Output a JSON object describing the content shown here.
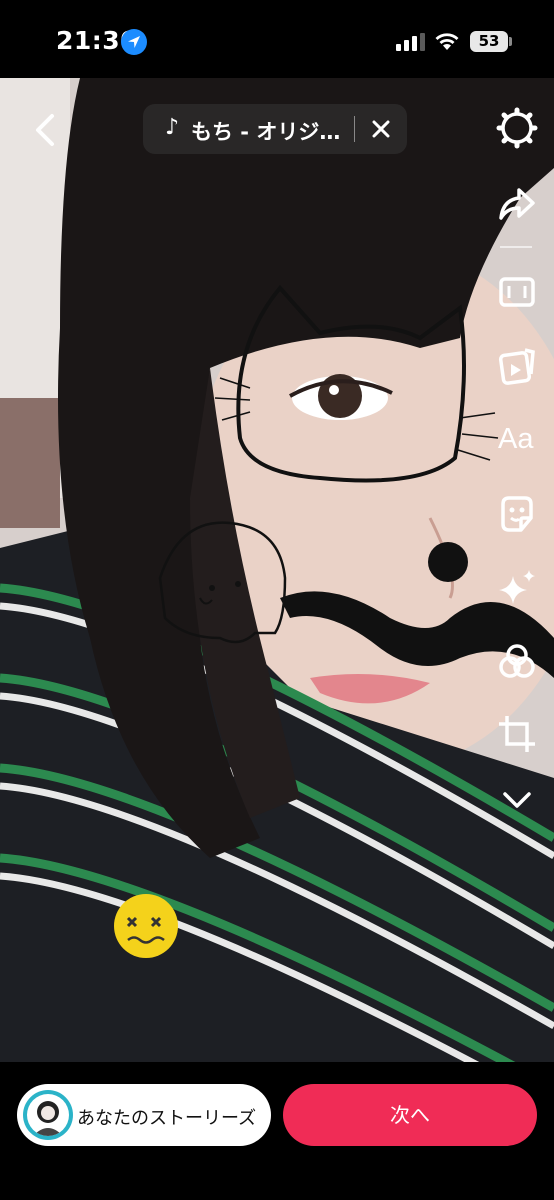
{
  "status_bar": {
    "time": "21:30",
    "location_icon": "location-arrow-icon",
    "signal_icon": "cellular-signal-icon",
    "wifi_icon": "wifi-icon",
    "battery_level": "53"
  },
  "editor": {
    "back_icon": "chevron-left-icon",
    "music": {
      "icon": "music-note-icon",
      "note_glyph": "♪",
      "title": "もち - オリジ…",
      "close_icon": "close-icon"
    },
    "tools": [
      {
        "name": "settings-icon"
      },
      {
        "name": "share-icon"
      },
      {
        "name": "aspect-ratio-icon"
      },
      {
        "name": "clip-icon"
      },
      {
        "name": "text-tool",
        "label": "Aa"
      },
      {
        "name": "sticker-icon"
      },
      {
        "name": "effects-icon"
      },
      {
        "name": "filters-icon"
      },
      {
        "name": "crop-icon"
      },
      {
        "name": "chevron-down-icon"
      }
    ]
  },
  "bottom": {
    "story_label": "あなたのストーリーズ",
    "next_label": "次へ"
  },
  "colors": {
    "accent": "#f02c56",
    "avatar_ring": "#2bb3c8",
    "location": "#1c8cff"
  }
}
